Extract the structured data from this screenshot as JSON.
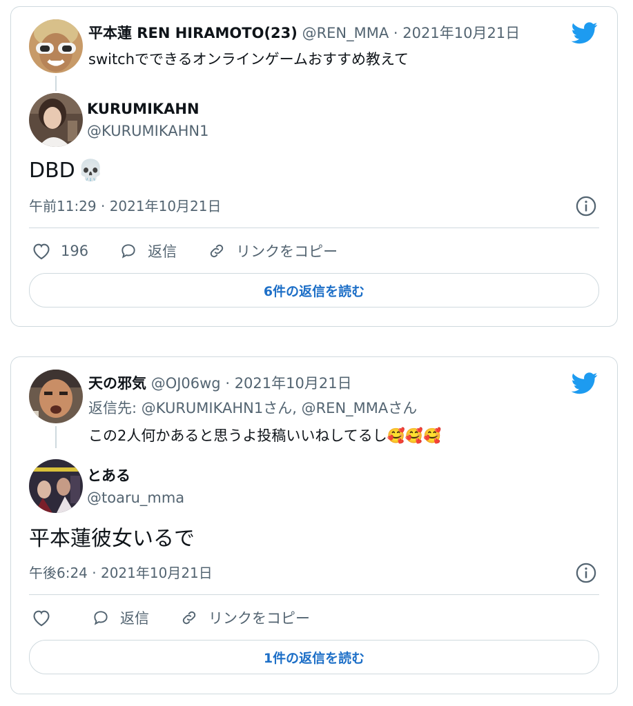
{
  "colors": {
    "accent": "#1d9bf0",
    "link": "#1d6fc7",
    "muted": "#536471",
    "border": "#cfd9de"
  },
  "tweets": [
    {
      "parent": {
        "name": "平本蓮 REN HIRAMOTO(23)",
        "handle": "@REN_MMA",
        "date": "2021年10月21日",
        "text": "switchでできるオンラインゲームおすすめ教えて",
        "avatar_icon": "avatar-sunglasses"
      },
      "reply": {
        "name": "KURUMIKAHN",
        "handle": "@KURUMIKAHN1",
        "text": "DBD",
        "emoji": "💀",
        "timestamp": "午前11:29 · 2021年10月21日"
      },
      "actions": {
        "likes": "196",
        "reply_label": "返信",
        "copy_link_label": "リンクをコピー"
      },
      "read_replies_label": "6件の返信を読む"
    },
    {
      "parent": {
        "name": "天の邪気",
        "handle": "@OJ06wg",
        "date": "2021年10月21日",
        "reply_prefix": "返信先: ",
        "reply_to": "@KURUMIKAHN1さん, @REN_MMAさん",
        "text": "この2人何かあると思うよ投稿いいねしてるし",
        "emoji": "🥰🥰🥰",
        "avatar_icon": "avatar-man"
      },
      "reply": {
        "name": "とある",
        "handle": "@toaru_mma",
        "text": "平本蓮彼女いるで",
        "emoji": "",
        "timestamp": "午後6:24 · 2021年10月21日"
      },
      "actions": {
        "likes": "",
        "reply_label": "返信",
        "copy_link_label": "リンクをコピー"
      },
      "read_replies_label": "1件の返信を読む"
    }
  ]
}
